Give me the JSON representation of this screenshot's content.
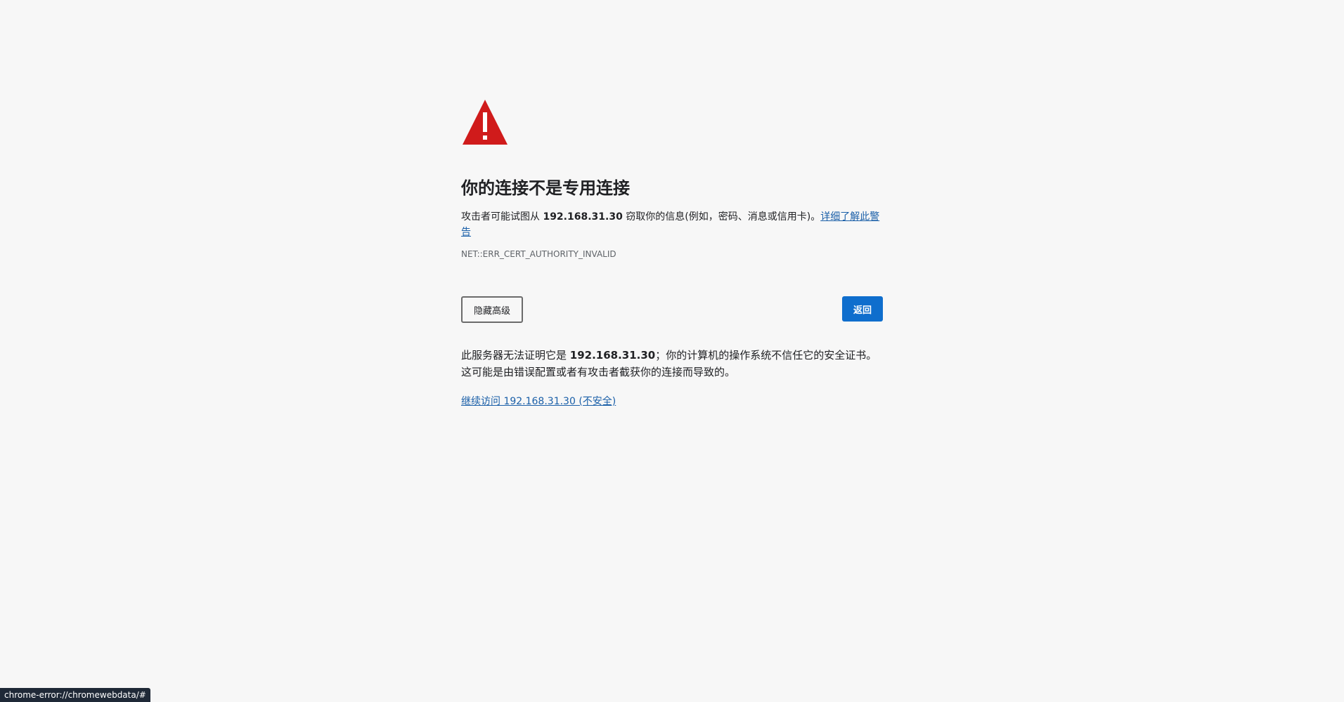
{
  "page": {
    "title": "你的连接不是专用连接",
    "summary": {
      "prefix": "攻击者可能试图从 ",
      "host": "192.168.31.30",
      "suffix": " 窃取你的信息(例如，密码、消息或信用卡)。",
      "learn_more_link": "详细了解此警告"
    },
    "error_code": "NET::ERR_CERT_AUTHORITY_INVALID",
    "buttons": {
      "hide_advanced": "隐藏高级",
      "back": "返回"
    },
    "explanation": {
      "prefix": "此服务器无法证明它是 ",
      "host": "192.168.31.30",
      "suffix": "；你的计算机的操作系统不信任它的安全证书。这可能是由错误配置或者有攻击者截获你的连接而导致的。"
    },
    "proceed_link": "继续访问 192.168.31.30 (不安全)"
  },
  "status_bar": {
    "url": "chrome-error://chromewebdata/#"
  },
  "icons": {
    "warning": "warning-triangle-icon"
  },
  "colors": {
    "background": "#f7f7f7",
    "warning_red": "#d01b1b",
    "primary_button": "#0f6ecd",
    "link": "#1a5fa8",
    "status_bar_bg": "#1f2937"
  }
}
